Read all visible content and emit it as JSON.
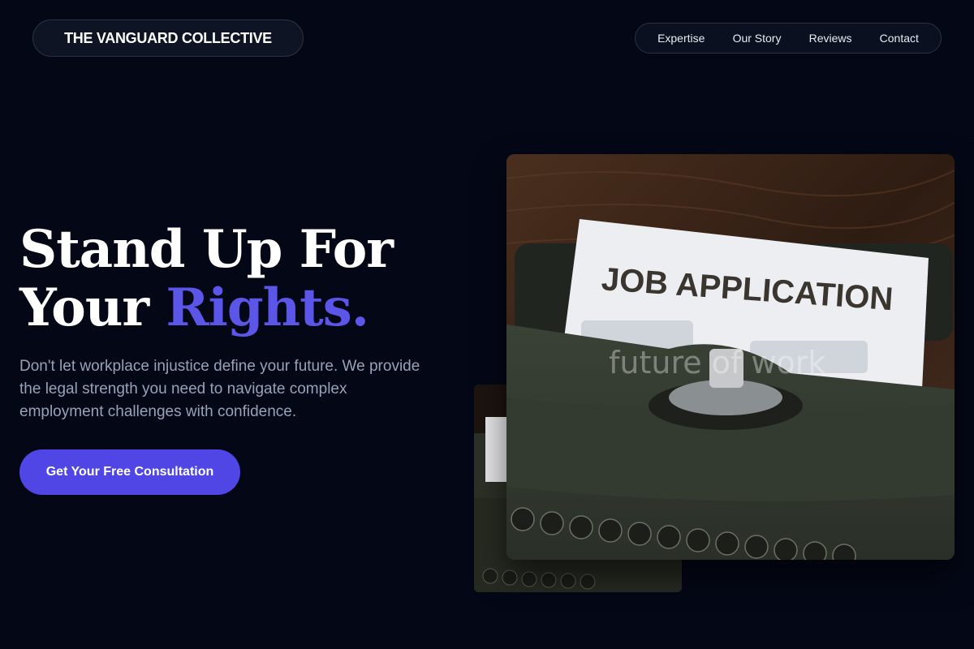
{
  "brand": {
    "name": "THE VANGUARD COLLECTIVE"
  },
  "nav": {
    "items": [
      {
        "label": "Expertise"
      },
      {
        "label": "Our Story"
      },
      {
        "label": "Reviews"
      },
      {
        "label": "Contact"
      }
    ]
  },
  "hero": {
    "headline_line1": "Stand Up For",
    "headline_line2_start": "Your ",
    "headline_accent": "Rights.",
    "description": "Don't let workplace injustice define your future. We provide the legal strength you need to navigate complex employment challenges with confidence.",
    "cta_label": "Get Your Free Consultation"
  },
  "photo": {
    "paper_text": "JOB APPLICATION",
    "watermark_text": "future of work"
  },
  "colors": {
    "background": "#040816",
    "accent": "#5b55e8",
    "button": "#4f46e5",
    "muted_text": "#97a2b8"
  }
}
